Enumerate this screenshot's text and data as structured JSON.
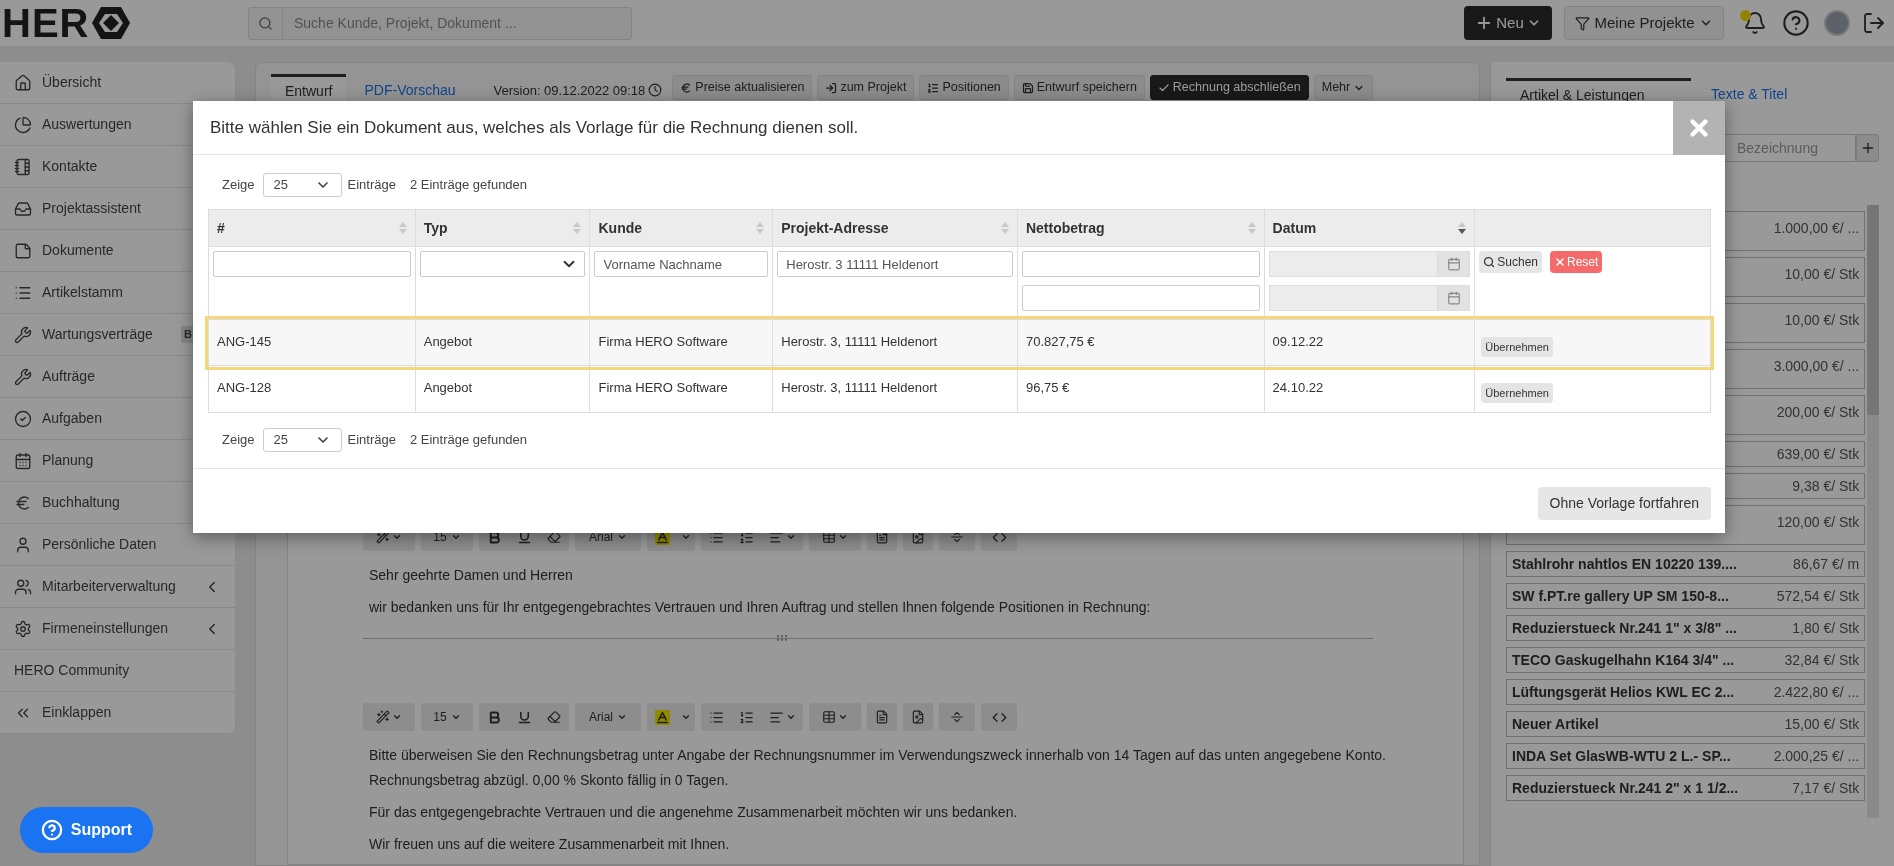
{
  "header": {
    "logo": "HER",
    "search": {
      "placeholder": "Suche Kunde, Projekt, Dokument ..."
    },
    "new_button": "Neu",
    "projects_button": "Meine Projekte",
    "notification": true
  },
  "sidebar": {
    "items": [
      {
        "label": "Übersicht",
        "expandable": false
      },
      {
        "label": "Auswertungen"
      },
      {
        "label": "Kontakte"
      },
      {
        "label": "Projektassistent"
      },
      {
        "label": "Dokumente"
      },
      {
        "label": "Artikelstamm"
      },
      {
        "label": "Wartungsverträge",
        "badge": "B"
      },
      {
        "label": "Aufträge"
      },
      {
        "label": "Aufgaben"
      },
      {
        "label": "Planung"
      },
      {
        "label": "Buchhaltung"
      },
      {
        "label": "Persönliche Daten",
        "expandable": false
      },
      {
        "label": "Mitarbeiterverwaltung",
        "expandable": true
      },
      {
        "label": "Firmeneinstellungen",
        "expandable": true
      },
      {
        "label": "HERO Community",
        "expandable": false
      },
      {
        "label": "Einklappen",
        "expandable": false
      }
    ],
    "support_button": "Support"
  },
  "editor": {
    "tabs": [
      {
        "label": "Entwurf",
        "selected": true
      },
      {
        "label": "PDF-Vorschau",
        "selected": false
      }
    ],
    "version": "Version: 09.12.2022 09:18",
    "actions": [
      {
        "label": "Preise aktualisieren",
        "primary": false,
        "dropdown": false
      },
      {
        "label": "zum Projekt",
        "primary": false,
        "dropdown": false
      },
      {
        "label": "Positionen",
        "primary": false,
        "dropdown": false
      },
      {
        "label": "Entwurf speichern",
        "primary": false,
        "dropdown": false
      },
      {
        "label": "Rechnung abschließen",
        "primary": true,
        "dropdown": false
      },
      {
        "label": "Mehr",
        "primary": false,
        "dropdown": true
      }
    ],
    "sections": [
      {
        "toolbar": {
          "size": "15",
          "font": "Arial"
        },
        "paragraphs": [
          "Sehr geehrte Damen und Herren",
          "wir bedanken uns für Ihr entgegengebrachtes Vertrauen und Ihren Auftrag und stellen Ihnen folgende Positionen in Rechnung:"
        ]
      },
      {
        "toolbar": {
          "size": "15",
          "font": "Arial"
        },
        "paragraphs": [
          "Bitte überweisen Sie den Rechnungsbetrag unter Angabe der Rechnungsnummer im Verwendungszweck innerhalb von 14 Tagen auf das unten angegebene Konto. Rechnungsbetrag abzügl. 0,00 % Skonto fällig in 0 Tagen.",
          "Für das entgegengebrachte Vertrauen und die angenehme Zusammenarbeit möchten wir uns bedanken.",
          "Wir freuen uns auf die weitere Zusammenarbeit mit Ihnen."
        ]
      }
    ]
  },
  "articles": {
    "tabs": [
      {
        "label": "Artikel & Leistungen",
        "selected": true
      },
      {
        "label": "Texte & Titel",
        "selected": false
      }
    ],
    "search": {
      "placeholder": "Bezeichnung"
    },
    "items": [
      {
        "price": "1.000,00 €/ ...",
        "tall": true
      },
      {
        "price": "10,00 €/ Stk",
        "tall": true
      },
      {
        "price": "10,00 €/ Stk",
        "tall": true
      },
      {
        "price": "3.000,00 €/ ...",
        "tall": true
      },
      {
        "price": "200,00 €/ Stk",
        "tall": true
      },
      {
        "price": "639,00 €/ Stk",
        "tall": false
      },
      {
        "price": "9,38 €/ Stk",
        "tall": false
      },
      {
        "price": "120,00 €/ Stk",
        "tall": true
      },
      {
        "name": "Stahlrohr nahtlos EN 10220 139....",
        "price": "86,67 €/ m",
        "tall": false
      },
      {
        "name": "SW f.PT.re gallery UP SM 150-8...",
        "price": "572,54 €/ Stk",
        "tall": false
      },
      {
        "name": "Reduzierstueck Nr.241 1\" x 3/8\" ...",
        "price": "1,80 €/ Stk",
        "tall": false
      },
      {
        "name": "TECO Gaskugelhahn K164 3/4\" ...",
        "price": "32,84 €/ Stk",
        "tall": false
      },
      {
        "name": "Lüftungsgerät Helios KWL EC 2...",
        "price": "2.422,80 €/ ...",
        "tall": false
      },
      {
        "name": "Neuer Artikel",
        "price": "15,00 €/ Stk",
        "tall": false
      },
      {
        "name": "INDA Set GlasWB-WTU 2 L.- SP...",
        "price": "2.000,25 €/ ...",
        "tall": false
      },
      {
        "name": "Reduzierstueck Nr.241 2\" x 1 1/2...",
        "price": "7,17 €/ Stk",
        "tall": false
      }
    ]
  },
  "modal": {
    "title": "Bitte wählen Sie ein Dokument aus, welches als Vorlage für die Rechnung dienen soll.",
    "top_pager": {
      "label": "Zeige",
      "value": "25",
      "suffix": "Einträge",
      "count": "2 Einträge gefunden"
    },
    "table": {
      "columns": [
        {
          "label": "#",
          "sorted": false
        },
        {
          "label": "Typ",
          "sorted": false
        },
        {
          "label": "Kunde",
          "sorted": false
        },
        {
          "label": "Projekt-Adresse",
          "sorted": false
        },
        {
          "label": "Nettobetrag",
          "sorted": false
        },
        {
          "label": "Datum",
          "sorted": true
        }
      ],
      "filters": [
        {
          "kind": "text"
        },
        {
          "kind": "select"
        },
        {
          "kind": "text",
          "placeholder": "Vorname Nachname"
        },
        {
          "kind": "text",
          "placeholder": "Herostr. 3 11111 Heldenort"
        },
        {
          "kind": "range"
        },
        {
          "kind": "date_range"
        },
        {
          "kind": "buttons",
          "search": "Suchen",
          "reset": "Reset"
        }
      ],
      "rows": [
        {
          "cells": [
            "ANG-145",
            "Angebot",
            "Firma HERO Software",
            "Herostr. 3, 11111 Heldenort",
            "70.827,75 €",
            "09.12.22"
          ],
          "action": "Übernehmen",
          "highlighted": true
        },
        {
          "cells": [
            "ANG-128",
            "Angebot",
            "Firma HERO Software",
            "Herostr. 3, 11111 Heldenort",
            "96,75 €",
            "24.10.22"
          ],
          "action": "Übernehmen",
          "highlighted": false
        }
      ]
    },
    "bottom_pager": {
      "label": "Zeige",
      "value": "25",
      "suffix": "Einträge",
      "count": "2 Einträge gefunden"
    },
    "footer_button": "Ohne Vorlage fortfahren"
  }
}
